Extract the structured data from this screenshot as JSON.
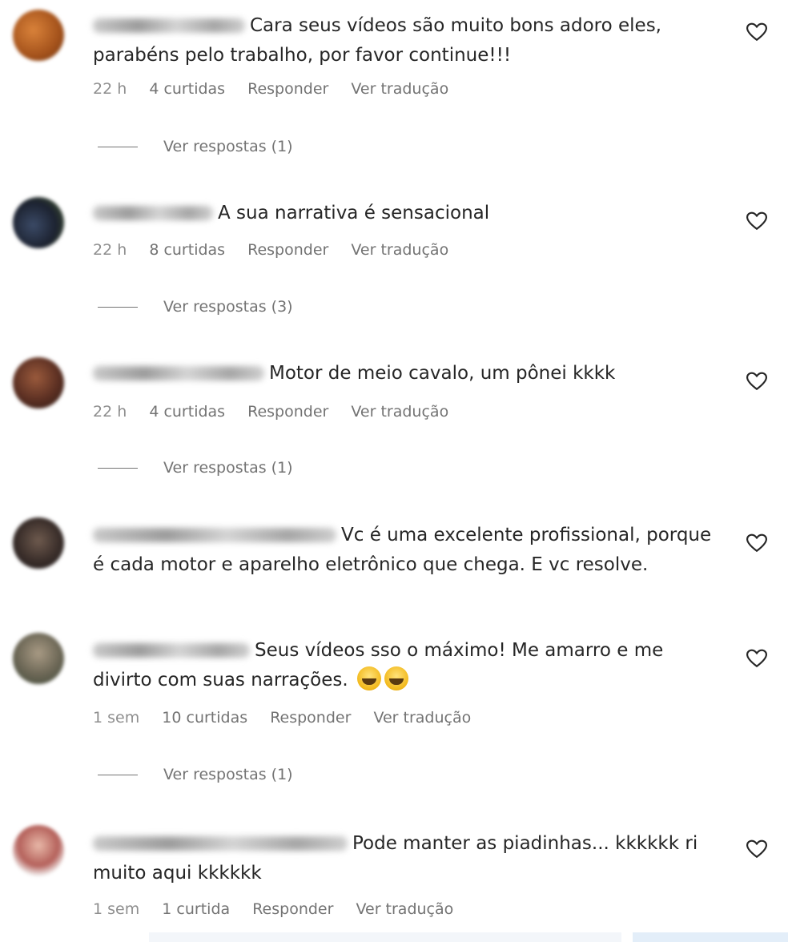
{
  "comments": [
    {
      "text": "Cara seus vídeos são muito bons adoro eles, parabéns pelo trabalho, por favor continue!!!",
      "time": "22 h",
      "likes": "4 curtidas",
      "reply": "Responder",
      "translate": "Ver tradução",
      "replies": "Ver respostas (1)"
    },
    {
      "text": "A sua narrativa é sensacional",
      "time": "22 h",
      "likes": "8 curtidas",
      "reply": "Responder",
      "translate": "Ver tradução",
      "replies": "Ver respostas (3)"
    },
    {
      "text": "Motor de meio cavalo, um pônei kkkk",
      "time": "22 h",
      "likes": "4 curtidas",
      "reply": "Responder",
      "translate": "Ver tradução",
      "replies": "Ver respostas (1)"
    },
    {
      "text": "Vc é uma excelente profissional, porque é cada motor e aparelho eletrônico que chega. E vc resolve."
    },
    {
      "text": "Seus vídeos sso o máximo! Me amarro e me divirto com suas narrações.",
      "time": "1 sem",
      "likes": "10 curtidas",
      "reply": "Responder",
      "translate": "Ver tradução",
      "replies": "Ver respostas (1)"
    },
    {
      "text": "Pode manter as piadinhas... kkkkkk ri muito aqui kkkkkk",
      "time": "1 sem",
      "likes": "1 curtida",
      "reply": "Responder",
      "translate": "Ver tradução"
    }
  ],
  "icons": {
    "like": "heart-outline-icon",
    "emoji": "grinning-squinting-face-emoji"
  },
  "colors": {
    "text": "#262626",
    "meta": "#8e8e8e",
    "link": "#737373"
  }
}
